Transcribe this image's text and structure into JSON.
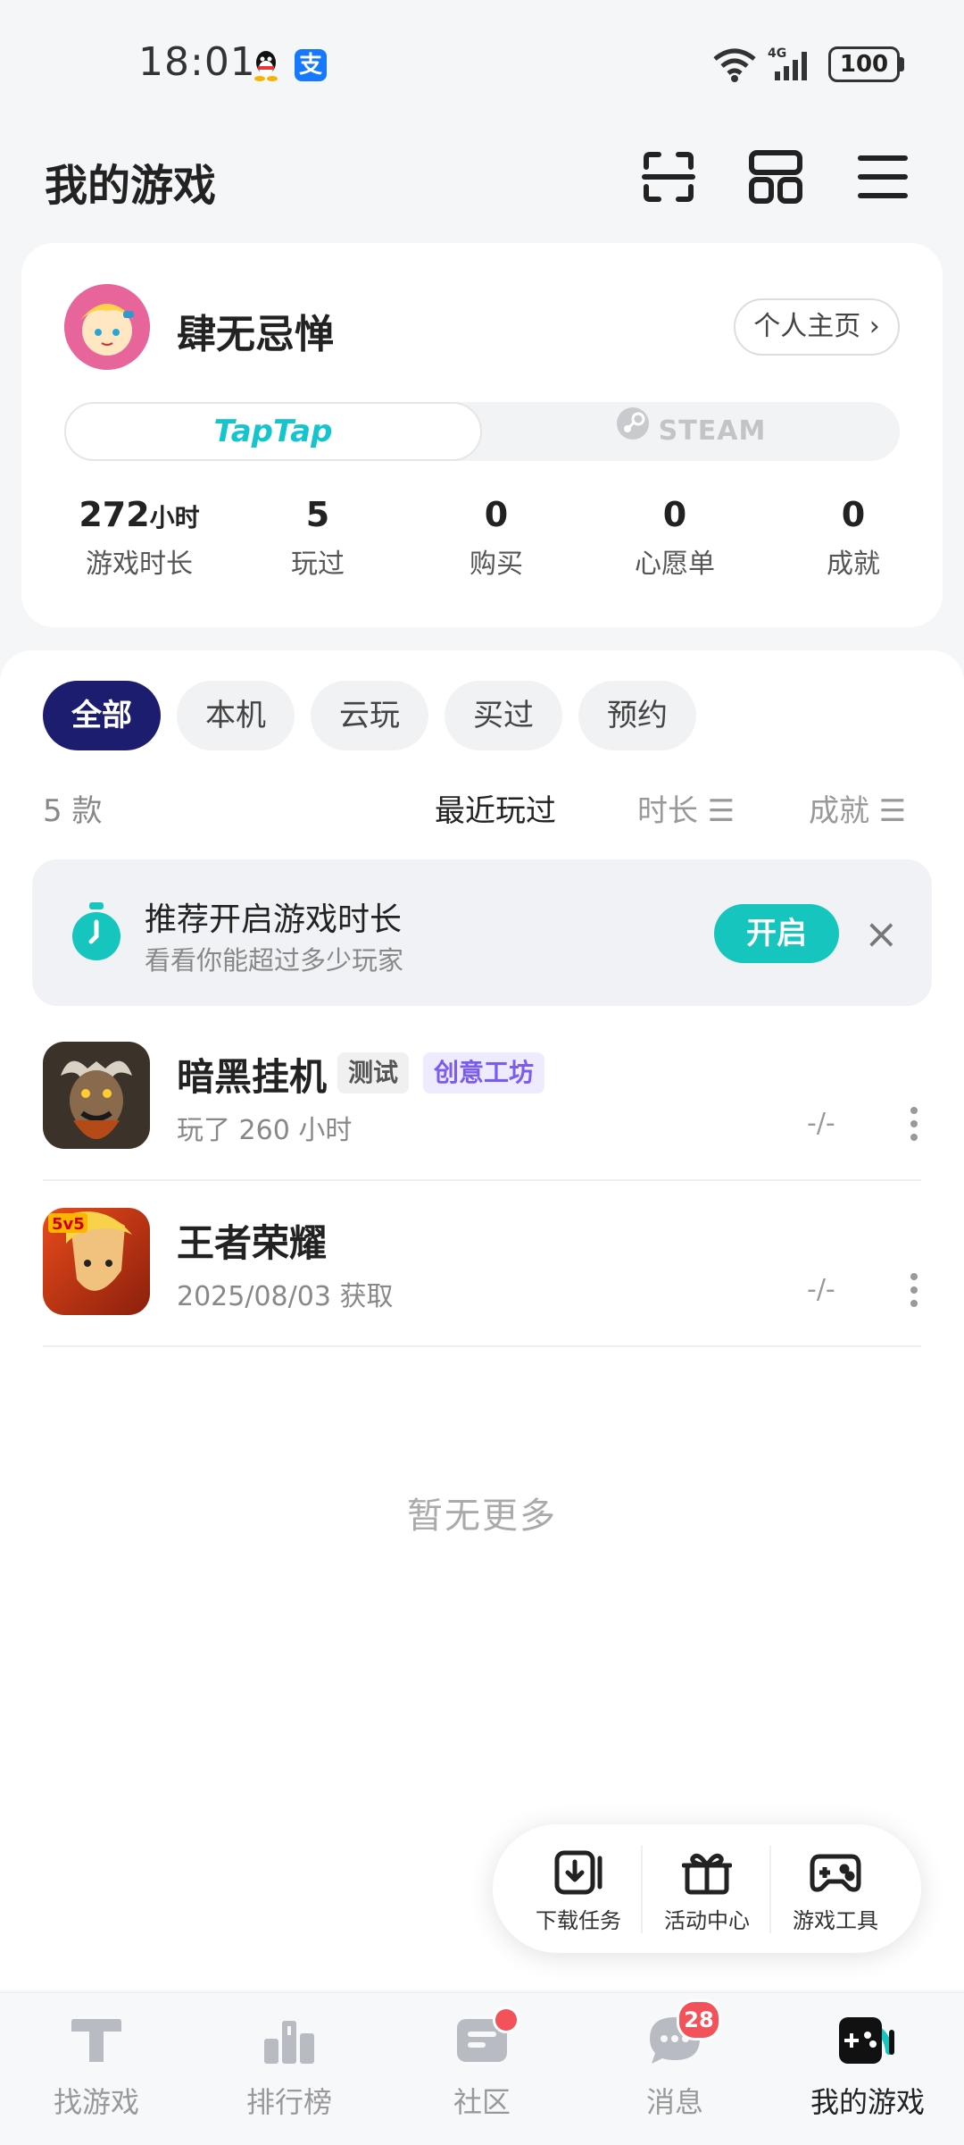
{
  "status_bar": {
    "time": "18:01",
    "network": "4G",
    "battery": "100"
  },
  "header": {
    "title": "我的游戏"
  },
  "profile": {
    "username": "肆无忌惮",
    "homepage_button": "个人主页 ›",
    "platforms": [
      "TapTap",
      "STEAM"
    ],
    "stats": [
      {
        "value": "272",
        "unit": "小时",
        "label": "游戏时长"
      },
      {
        "value": "5",
        "unit": "",
        "label": "玩过"
      },
      {
        "value": "0",
        "unit": "",
        "label": "购买"
      },
      {
        "value": "0",
        "unit": "",
        "label": "心愿单"
      },
      {
        "value": "0",
        "unit": "",
        "label": "成就"
      }
    ]
  },
  "filters": {
    "chips": [
      "全部",
      "本机",
      "云玩",
      "买过",
      "预约"
    ],
    "active": "全部"
  },
  "list_meta": {
    "count": "5 款",
    "sort_options": [
      "最近玩过",
      "时长 ☰",
      "成就 ☰"
    ]
  },
  "promo": {
    "title": "推荐开启游戏时长",
    "subtitle": "看看你能超过多少玩家",
    "button": "开启",
    "close": "×"
  },
  "games": [
    {
      "name": "暗黑挂机",
      "tags": [
        "测试",
        "创意工坊"
      ],
      "subtitle": "玩了 260 小时",
      "rating": "-/-"
    },
    {
      "name": "王者荣耀",
      "tags": [],
      "subtitle": "2025/08/03 获取",
      "rating": "-/-"
    }
  ],
  "no_more": "暂无更多",
  "tools": [
    "下载任务",
    "活动中心",
    "游戏工具"
  ],
  "bottom_nav": {
    "items": [
      "找游戏",
      "排行榜",
      "社区",
      "消息",
      "我的游戏"
    ],
    "active": "我的游戏",
    "message_badge": "28"
  },
  "colors": {
    "accent": "#15c5be",
    "active_chip": "#1c1d6e",
    "badge": "#f3525a",
    "tag_purple": "#7b5cf0"
  }
}
